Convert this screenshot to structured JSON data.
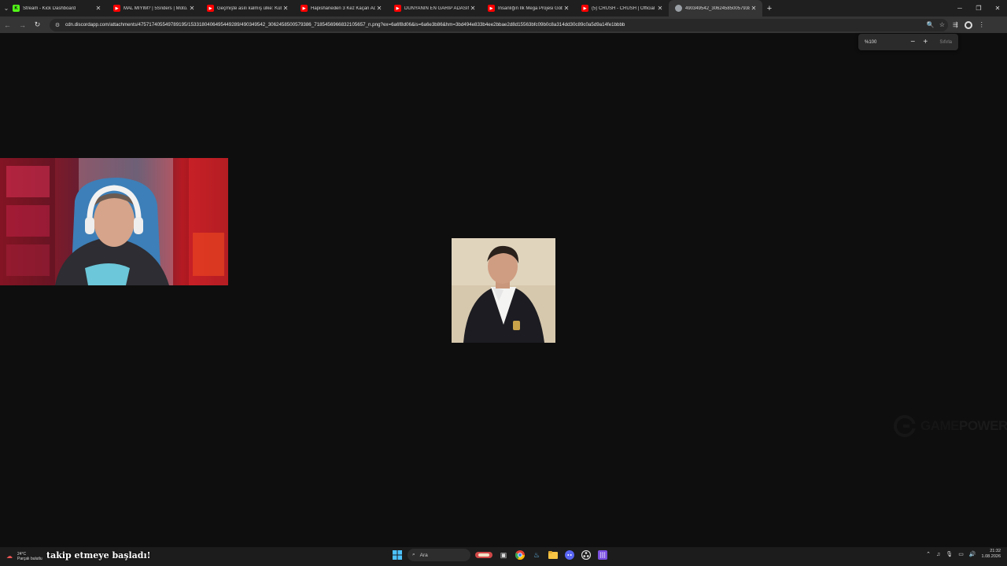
{
  "tabs": [
    {
      "title": "Stream - Kick Dashboard",
      "favicon": "kick-icon",
      "color": "#53fc18",
      "active": false
    },
    {
      "title": "MAL MIYIM? | 5Sriders | Moto...",
      "favicon": "youtube-icon",
      "color": "#ff0000",
      "active": false
    },
    {
      "title": "Geçmişte asılı kalmış ülke: Küba",
      "favicon": "youtube-icon",
      "color": "#ff0000",
      "active": false
    },
    {
      "title": "Hapishaneden 3 Kez Kaçan Adam",
      "favicon": "youtube-icon",
      "color": "#ff0000",
      "active": false
    },
    {
      "title": "DÜNYANIN EN GARİP ADASINI",
      "favicon": "youtube-icon",
      "color": "#ff0000",
      "active": false
    },
    {
      "title": "İnsanlığın İlk Mega Projesi Göb",
      "favicon": "youtube-icon",
      "color": "#ff0000",
      "active": false
    },
    {
      "title": "(5) CRUSH - CRUSH | Official M",
      "favicon": "youtube-icon",
      "color": "#ff0000",
      "active": false
    },
    {
      "title": "490349542_30624585005793861",
      "favicon": "globe-icon",
      "color": "#9aa0a6",
      "active": true
    }
  ],
  "address": {
    "url": "cdn.discordapp.com/attachments/475717405549789195/1533180406495449289/490349542_3062458500579386_718545696683210565​7_n.png?ex=6a6f8d06&is=6a6e3b86&hm=3bd494e833b4ee2bbae2d8d15563bfc09b0c8a314dd30c89c0a5d9a14fe1bbbb"
  },
  "zoom": {
    "value": "%100",
    "minus": "−",
    "plus": "+",
    "reset": "Sıfırla"
  },
  "watermark": {
    "part1": "GAME",
    "part2": "POWER"
  },
  "taskbar": {
    "weather_temp": "24°C",
    "weather_desc": "Parçalı bulutlu",
    "notification": "takip etmeye başladı!",
    "search_placeholder": "Ara",
    "time": "21:32",
    "date": "1.08.2026"
  }
}
